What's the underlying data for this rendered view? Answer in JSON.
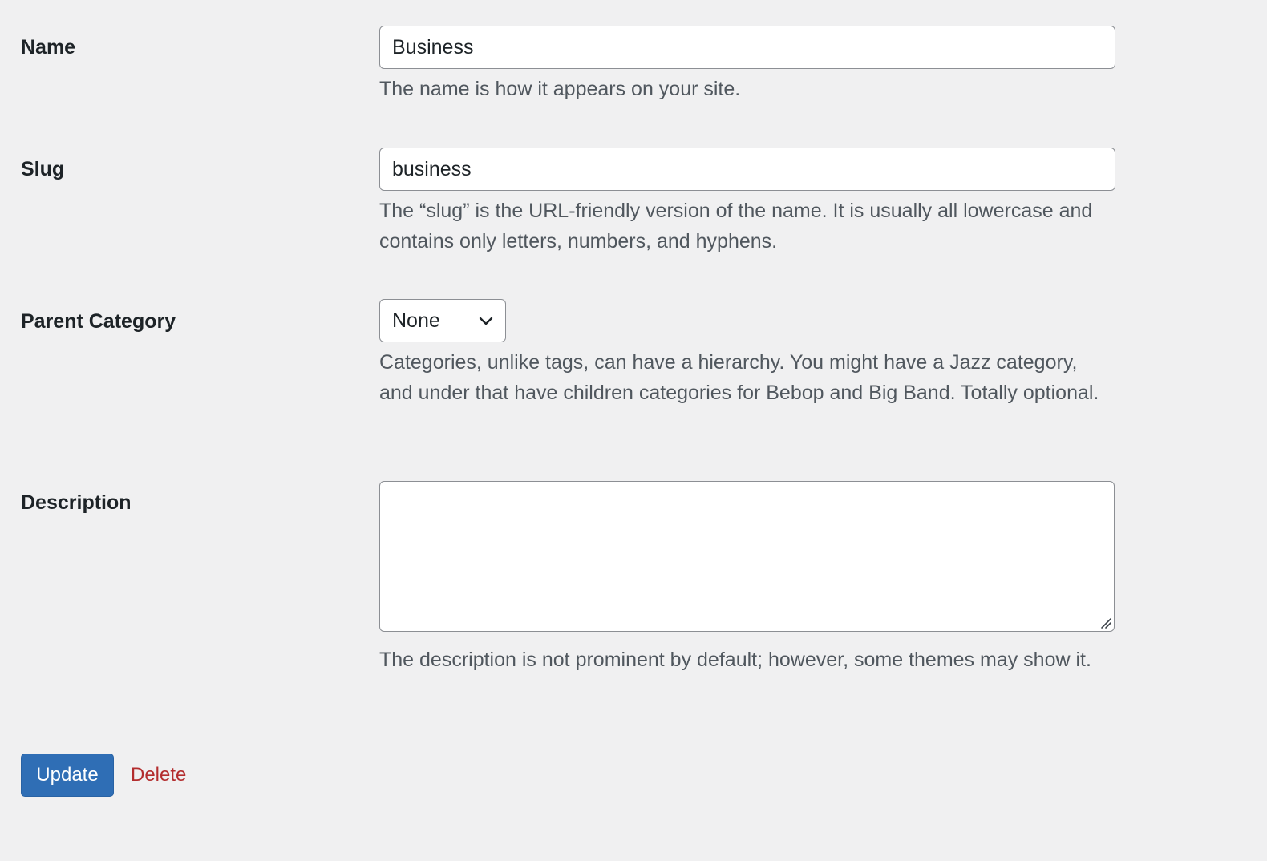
{
  "form": {
    "name": {
      "label": "Name",
      "value": "Business",
      "help": "The name is how it appears on your site."
    },
    "slug": {
      "label": "Slug",
      "value": "business",
      "help": "The “slug” is the URL-friendly version of the name. It is usually all lowercase and contains only letters, numbers, and hyphens."
    },
    "parent": {
      "label": "Parent Category",
      "selected": "None",
      "help": "Categories, unlike tags, can have a hierarchy. You might have a Jazz category, and under that have children categories for Bebop and Big Band. Totally optional."
    },
    "description": {
      "label": "Description",
      "value": "",
      "help": "The description is not prominent by default; however, some themes may show it."
    }
  },
  "actions": {
    "update_label": "Update",
    "delete_label": "Delete"
  },
  "icons": {
    "select": "chevron-down-icon",
    "textarea_resize": "resize-handle-icon"
  },
  "colors": {
    "background": "#f0f0f1",
    "primary": "#2f6eb5",
    "danger": "#b32d2e",
    "help_text": "#50575e",
    "label_text": "#1d2327",
    "input_border": "#8c8f94"
  }
}
